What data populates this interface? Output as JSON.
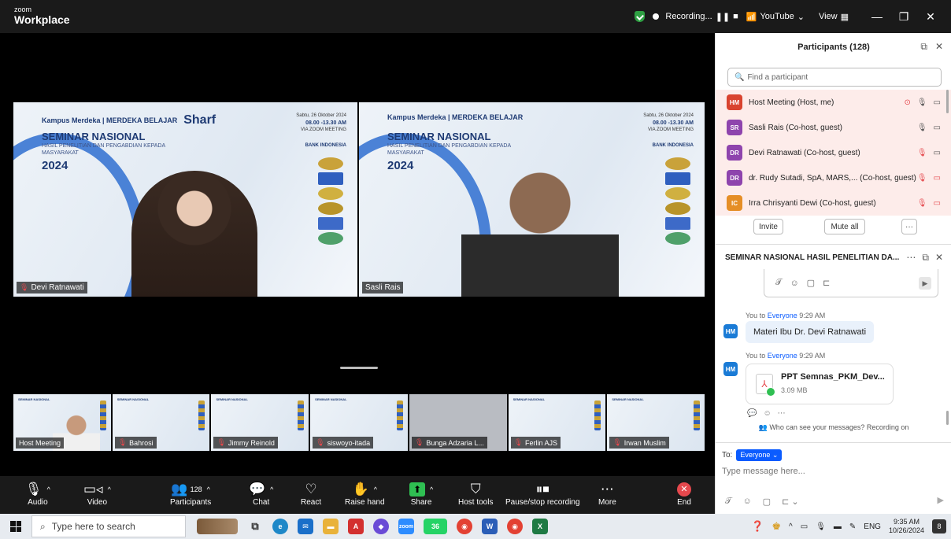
{
  "window": {
    "brand_small": "zoom",
    "brand_big": "Workplace",
    "recording_label": "Recording...",
    "youtube_label": "YouTube",
    "view_label": "View"
  },
  "stage": {
    "slide": {
      "logos_text": "Kampus Merdeka | MERDEKA BELAJAR",
      "sharf": "Sharf",
      "title": "SEMINAR NASIONAL",
      "subtitle": "HASIL PENELITIAN DAN PENGABDIAN KEPADA MASYARAKAT",
      "year": "2024",
      "date_line": "Sabtu, 26 Oktober 2024",
      "time_line": "08.00 -13.30 AM",
      "platform_line": "VIA ZOOM MEETING",
      "bank": "BANK INDONESIA"
    },
    "speakers": [
      {
        "name": "Devi Ratnawati"
      },
      {
        "name": "Sasli Rais"
      }
    ],
    "thumbnails": [
      {
        "name": "Host Meeting"
      },
      {
        "name": "Bahrosi"
      },
      {
        "name": "Jimmy Reinold"
      },
      {
        "name": "siswoyo-itada"
      },
      {
        "name": "Bunga Adzaria L..."
      },
      {
        "name": "Ferlin AJS"
      },
      {
        "name": "Irwan Muslim"
      }
    ]
  },
  "toolbar": {
    "audio": "Audio",
    "video": "Video",
    "participants": "Participants",
    "participants_count": "128",
    "chat": "Chat",
    "react": "React",
    "raise_hand": "Raise hand",
    "share": "Share",
    "host_tools": "Host tools",
    "pause_recording": "Pause/stop recording",
    "more": "More",
    "end": "End"
  },
  "participants_panel": {
    "title": "Participants (128)",
    "search_placeholder": "Find a participant",
    "rows": [
      {
        "initials": "HM",
        "color": "#d9432f",
        "name": "Host Meeting (Host, me)"
      },
      {
        "initials": "SR",
        "color": "#8e44ad",
        "name": "Sasli Rais (Co-host, guest)"
      },
      {
        "initials": "DR",
        "color": "#8e44ad",
        "name": "Devi Ratnawati (Co-host, guest)"
      },
      {
        "initials": "DR",
        "color": "#8e44ad",
        "name": "dr. Rudy Sutadi, SpA, MARS,... (Co-host, guest)"
      },
      {
        "initials": "IC",
        "color": "#e58e26",
        "name": "Irra Chrisyanti Dewi (Co-host, guest)"
      }
    ],
    "invite": "Invite",
    "mute_all": "Mute all",
    "more": "···"
  },
  "chat_panel": {
    "title": "SEMINAR NASIONAL HASIL PENELITIAN DA...",
    "messages": [
      {
        "meta_prefix": "You to",
        "meta_to": "Everyone",
        "time": "9:29 AM",
        "avatar": "HM",
        "text": "Materi Ibu Dr. Devi Ratnawati"
      },
      {
        "meta_prefix": "You to",
        "meta_to": "Everyone",
        "time": "9:29 AM",
        "avatar": "HM"
      }
    ],
    "file": {
      "name": "PPT Semnas_PKM_Dev...",
      "size": "3.09 MB"
    },
    "who_can_see": "Who can see your messages? Recording on",
    "to_label": "To:",
    "to_value": "Everyone",
    "input_placeholder": "Type message here..."
  },
  "taskbar": {
    "search_placeholder": "Type here to search",
    "lang": "ENG",
    "time": "9:35 AM",
    "date": "10/26/2024",
    "whatsapp_badge": "36",
    "notif_count": "8"
  }
}
